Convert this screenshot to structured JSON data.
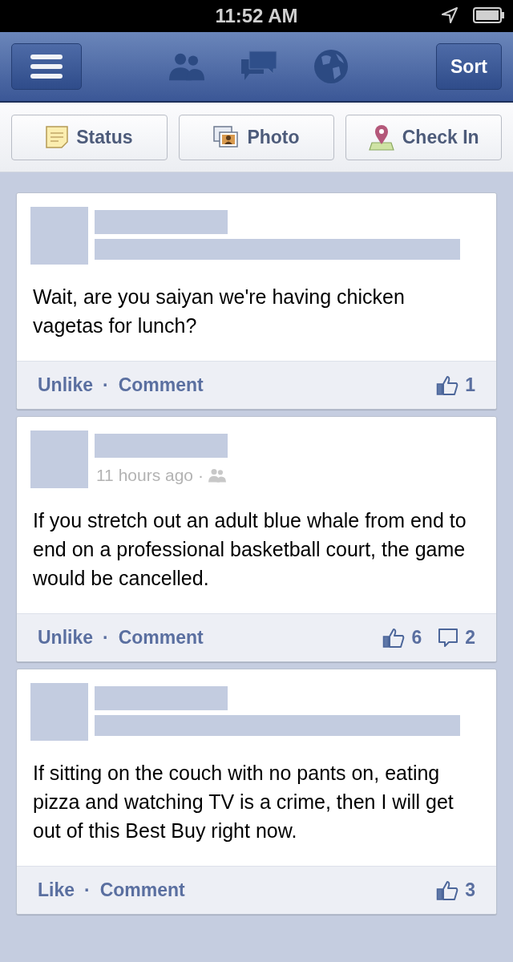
{
  "status_bar": {
    "time": "11:52 AM"
  },
  "nav": {
    "sort_button": "Sort"
  },
  "composer": [
    {
      "kind": "status",
      "label": "Status"
    },
    {
      "kind": "photo",
      "label": "Photo"
    },
    {
      "kind": "checkin",
      "label": "Check In"
    }
  ],
  "posts": [
    {
      "text": "Wait, are you saiyan we're having chicken vagetas for lunch?",
      "like_action": "Unlike",
      "separator": "·",
      "comment_action": "Comment",
      "likes": "1"
    },
    {
      "timestamp": "11 hours ago",
      "meta_separator": "·",
      "text": "If you stretch out an adult blue whale from end to end on a professional basketball court, the game would be cancelled.",
      "like_action": "Unlike",
      "separator": "·",
      "comment_action": "Comment",
      "likes": "6",
      "comments": "2"
    },
    {
      "text": "If sitting on the couch with no pants on, eating pizza and watching TV is a crime, then I will get out of this Best Buy right now.",
      "like_action": "Like",
      "separator": "·",
      "comment_action": "Comment",
      "likes": "3"
    }
  ]
}
